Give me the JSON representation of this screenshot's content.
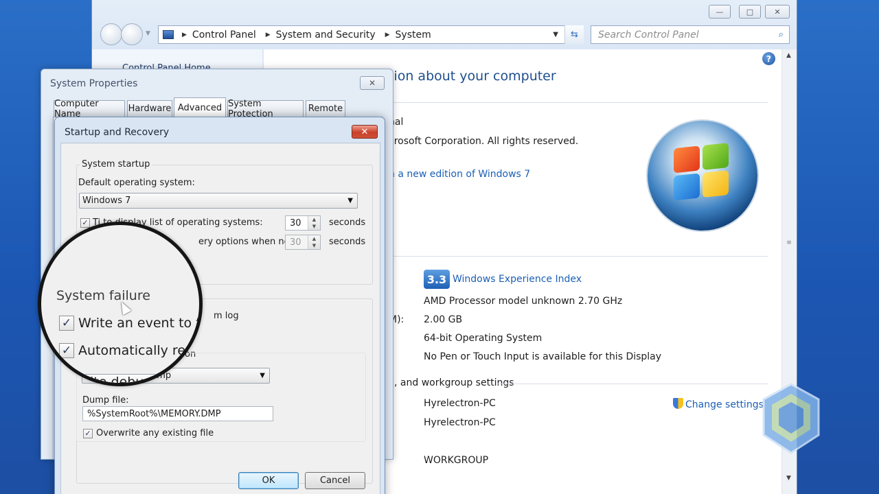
{
  "explorer": {
    "window_buttons": {
      "minimize": "—",
      "maximize": "□",
      "close": "✕"
    },
    "breadcrumb": [
      "Control Panel",
      "System and Security",
      "System"
    ],
    "search_placeholder": "Search Control Panel",
    "left_pane_link": "Control Panel Home",
    "heading_partial": "tion about your computer",
    "edition": {
      "line1": "nal",
      "line2": "crosoft Corporation.  All rights reserved.",
      "upgrade_link": "h a new edition of Windows 7"
    },
    "system": {
      "wei_score": "3.3",
      "wei_link": "Windows Experience Index",
      "processor": "AMD Processor model unknown   2.70 GHz",
      "memory_label_partial": "M):",
      "memory": "2.00 GB",
      "system_type": "64-bit Operating System",
      "pen_touch": "No Pen or Touch Input is available for this Display"
    },
    "computer_name_section": {
      "heading_partial": ", and workgroup settings",
      "computer_name": "Hyrelectron-PC",
      "full_name": "Hyrelectron-PC",
      "description_label_partial": ":",
      "workgroup": "WORKGROUP",
      "change_settings": "Change settings"
    }
  },
  "system_properties": {
    "title": "System Properties",
    "close": "✕",
    "tabs": [
      "Computer Name",
      "Hardware",
      "Advanced",
      "System Protection",
      "Remote"
    ],
    "active_tab": "Advanced"
  },
  "startup_recovery": {
    "title": "Startup and Recovery",
    "close": "✕",
    "system_startup": {
      "group_label": "System startup",
      "default_os_label": "Default operating system:",
      "default_os_value": "Windows 7",
      "display_list_label": "Time to display list of operating systems:",
      "display_list_visible": "Ti     to display list of operating systems:",
      "display_list_checked": true,
      "display_list_seconds": "30",
      "recovery_label_visible": "ery options when needed:",
      "recovery_seconds": "30",
      "seconds_unit": "seconds"
    },
    "system_failure": {
      "write_event_tail": "m log",
      "restart_tail": "on",
      "debug_combo_tail": "ump",
      "dump_file_label": "Dump file:",
      "dump_file_value": "%SystemRoot%\\MEMORY.DMP",
      "overwrite_label": "Overwrite any existing file",
      "overwrite_checked": true
    },
    "ok_label": "OK",
    "cancel_label": "Cancel"
  },
  "magnifier": {
    "title": "System failure",
    "write_event": "Write an event to th",
    "auto_restart": "Automatically resta",
    "debug_info": "ite debuggi"
  },
  "colors": {
    "desktop": "#1c57b4",
    "link": "#1a5fb4",
    "heading": "#1e4e8c",
    "close_red": "#c8412b"
  },
  "icons": [
    "monitor-icon",
    "refresh-icon",
    "search-icon",
    "help-icon",
    "shield-icon",
    "windows-logo-icon",
    "cursor-icon"
  ]
}
